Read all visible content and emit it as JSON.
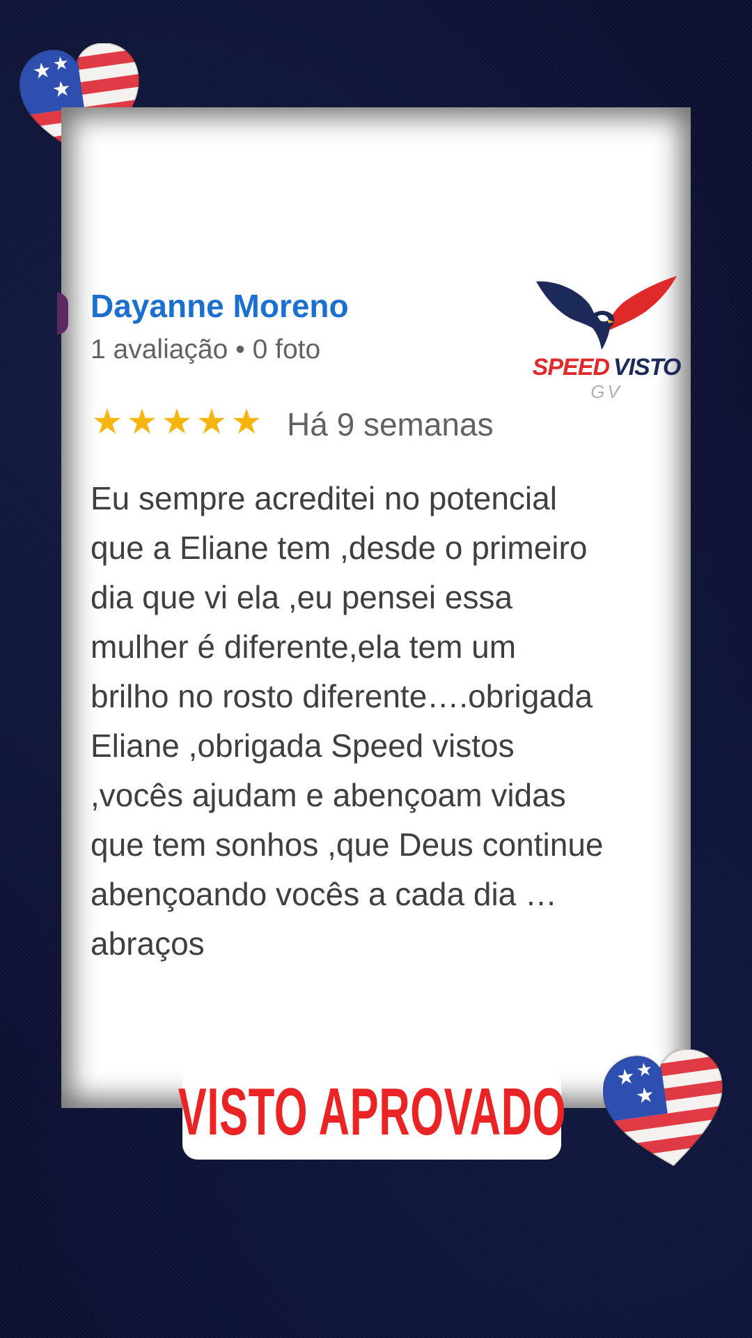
{
  "review": {
    "reviewer_name": "Dayanne Moreno",
    "reviewer_meta": "1 avaliação • 0 foto",
    "rating": 5,
    "time": "Há 9 semanas",
    "text": "Eu sempre acreditei no potencial\nque a Eliane tem ,desde o primeiro\ndia que vi ela ,eu pensei essa\nmulher é diferente,ela tem um\nbrilho no rosto diferente….obrigada\nEliane ,obrigada Speed vistos\n,vocês ajudam e abençoam vidas\nque tem sonhos ,que Deus continue\nabençoando vocês a cada dia …\nabraços"
  },
  "logo": {
    "word_speed": "SPEED",
    "word_visto": "VISTO",
    "sub": "GV"
  },
  "badge": {
    "label": "VISTO APROVADO"
  },
  "colors": {
    "background": "#0b1030",
    "name_blue": "#1a6fd0",
    "star_gold": "#f6b40e",
    "badge_red": "#ea2424",
    "logo_red": "#e02a2a",
    "logo_navy": "#1c2a5a"
  },
  "icons": [
    "us-flag-heart-icon",
    "star-icon",
    "eagle-icon"
  ]
}
